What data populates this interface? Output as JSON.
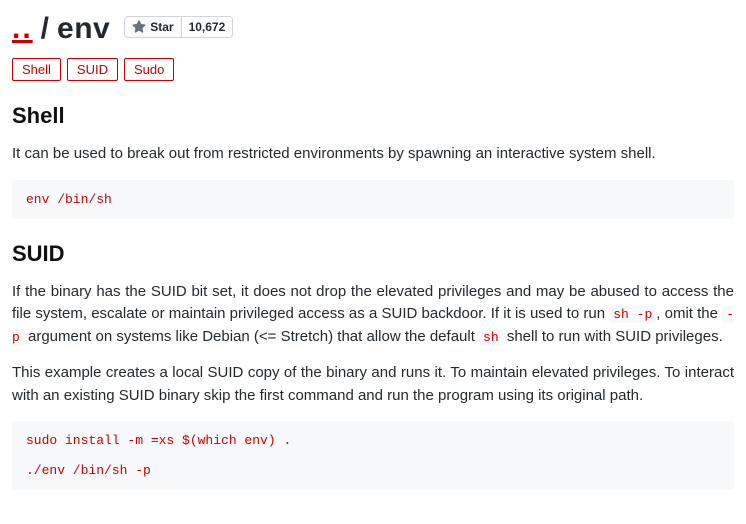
{
  "header": {
    "parent": "..",
    "separator": "/",
    "name": "env",
    "star_label": "Star",
    "star_count": "10,672"
  },
  "tags": [
    "Shell",
    "SUID",
    "Sudo"
  ],
  "sections": {
    "shell": {
      "title": "Shell",
      "para1": "It can be used to break out from restricted environments by spawning an interactive system shell.",
      "code": "env /bin/sh"
    },
    "suid": {
      "title": "SUID",
      "para1_a": "If the binary has the SUID bit set, it does not drop the elevated privileges and may be abused to access the file system, escalate or maintain privileged access as a SUID backdoor. If it is used to run ",
      "code1": "sh -p",
      "para1_b": ", omit the ",
      "code2": "-p",
      "para1_c": " argument on systems like Debian (<= Stretch) that allow the default ",
      "code3": "sh",
      "para1_d": " shell to run with SUID privileges.",
      "para2": "This example creates a local SUID copy of the binary and runs it. To maintain elevated privileges. To interact with an existing SUID binary skip the first command and run the program using its original path.",
      "code_block": "sudo install -m =xs $(which env) .\n\n./env /bin/sh -p"
    }
  }
}
